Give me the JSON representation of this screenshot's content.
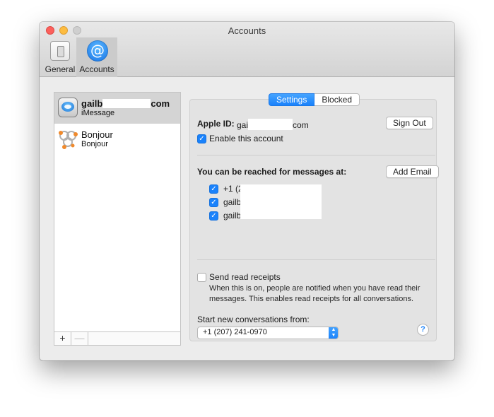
{
  "window": {
    "title": "Accounts"
  },
  "toolbar": {
    "general_label": "General",
    "accounts_label": "Accounts",
    "accounts_glyph": "@"
  },
  "sidebar": {
    "accounts": [
      {
        "name": "gailb",
        "name_tail": "com",
        "type": "iMessage",
        "selected": true
      },
      {
        "name": "Bonjour",
        "type": "Bonjour",
        "selected": false
      }
    ],
    "add_label": "+",
    "remove_label": "—"
  },
  "tabs": {
    "settings": "Settings",
    "blocked": "Blocked",
    "active": "Settings"
  },
  "settings": {
    "apple_id_label": "Apple ID:",
    "apple_id_value": "gai",
    "apple_id_tail": "com",
    "sign_out": "Sign Out",
    "enable_label": "Enable this account",
    "enable_checked": true,
    "reached_label": "You can be reached for messages at:",
    "add_email": "Add Email",
    "addresses": [
      {
        "text": "+1 (2",
        "checked": true
      },
      {
        "text": "gailb",
        "checked": true
      },
      {
        "text": "gailb",
        "checked": true
      }
    ],
    "read_receipts_label": "Send read receipts",
    "read_receipts_checked": false,
    "read_receipts_desc": "When this is on, people are notified when you have read their messages. This enables read receipts for all conversations.",
    "start_label": "Start new conversations from:",
    "start_value": "+1 (207) 241-0970",
    "help": "?"
  },
  "colors": {
    "accent": "#1a82fb",
    "selection": "#d4d4d4",
    "window_bg": "#ececec"
  },
  "icons": [
    "general-icon",
    "at-sign-icon",
    "imessage-icon",
    "bonjour-icon",
    "checkmark-icon",
    "help-icon",
    "popup-chevrons-icon"
  ]
}
